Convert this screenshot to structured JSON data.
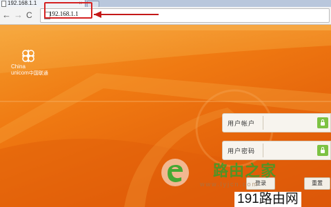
{
  "browser": {
    "tab_title": "192.168.1.1",
    "tab_close": "×",
    "back_glyph": "←",
    "forward_glyph": "→",
    "reload_glyph": "C",
    "url": "192.168.1.1"
  },
  "brand": {
    "logo_en_line1": "China",
    "logo_en_line2": "unicom",
    "logo_cn": "中国联通",
    "knot_color": "#ffffff"
  },
  "login": {
    "username_label": "用户帐户",
    "password_label": "用户密码",
    "username_value": "",
    "password_value": "",
    "login_button": "登录",
    "reset_button": "重置"
  },
  "watermark": {
    "brand_text": "路由之家",
    "url_text": "www.lyjcn.com",
    "corner_text": "191路由网",
    "accent_green": "#3a9d2a"
  },
  "colors": {
    "page_orange": "#f07a12",
    "annotation_red": "#d42020",
    "lock_green": "#7dc243"
  }
}
